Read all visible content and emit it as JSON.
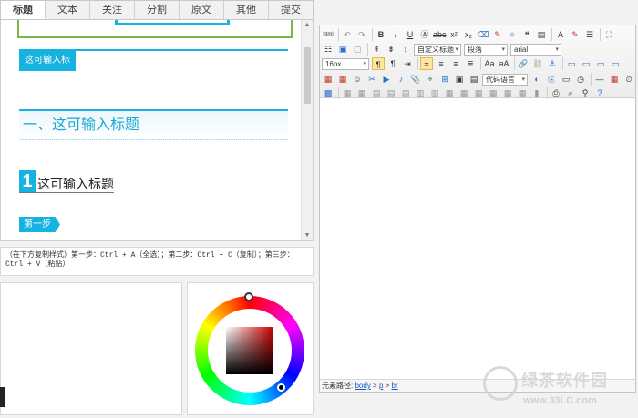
{
  "tabs": [
    {
      "label": "标题",
      "active": true
    },
    {
      "label": "文本",
      "active": false
    },
    {
      "label": "关注",
      "active": false
    },
    {
      "label": "分割",
      "active": false
    },
    {
      "label": "原文",
      "active": false
    },
    {
      "label": "其他",
      "active": false
    },
    {
      "label": "提交",
      "active": false
    }
  ],
  "preview": {
    "title_style1": "这可输入标题",
    "title_style2": "一、这可输入标题",
    "title_style3_number": "1",
    "title_style3_text": "这可输入标题",
    "step_label": "第一步"
  },
  "instructions": "（在下方复制样式）第一步：Ctrl + A（全选）；第二步：Ctrl + C（复制）；第三步：Ctrl + V（粘贴）",
  "editor": {
    "toolbar": {
      "html_label": "html",
      "bold": "B",
      "italic": "I",
      "underline": "U",
      "font_color": "A",
      "custom_title_select": "自定义标题",
      "paragraph_select": "段落",
      "font_select": "arial",
      "size_select": "16px",
      "code_lang_select": "代码语言"
    },
    "path": {
      "label": "元素路径:",
      "items": [
        "body",
        "p",
        "br"
      ],
      "separator": " > "
    }
  },
  "watermark": {
    "name": "绿茶软件园",
    "url": "www.33LC.com"
  },
  "colors": {
    "accent": "#16b2e0",
    "frame_green": "#7ab648"
  }
}
